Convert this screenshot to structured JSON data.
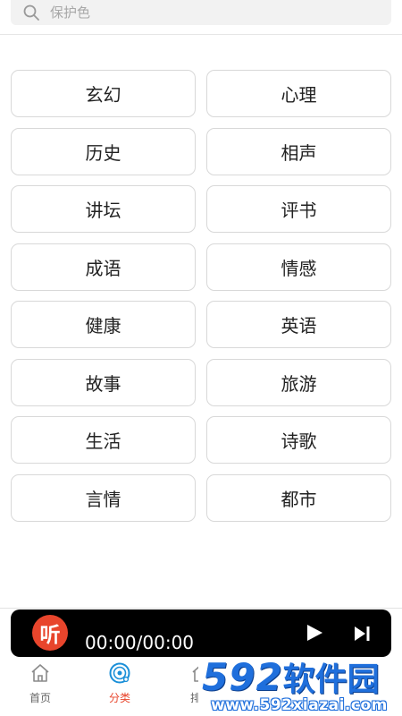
{
  "search": {
    "placeholder": "保护色",
    "icon": "search-icon"
  },
  "categories": [
    {
      "label": "玄幻"
    },
    {
      "label": "心理"
    },
    {
      "label": "历史"
    },
    {
      "label": "相声"
    },
    {
      "label": "讲坛"
    },
    {
      "label": "评书"
    },
    {
      "label": "成语"
    },
    {
      "label": "情感"
    },
    {
      "label": "健康"
    },
    {
      "label": "英语"
    },
    {
      "label": "故事"
    },
    {
      "label": "旅游"
    },
    {
      "label": "生活"
    },
    {
      "label": "诗歌"
    },
    {
      "label": "言情"
    },
    {
      "label": "都市"
    }
  ],
  "player": {
    "logo_text": "听",
    "time": "00:00/00:00",
    "play_icon": "play-icon",
    "next_icon": "skip-next-icon"
  },
  "tabs": [
    {
      "label": "首页",
      "icon": "home-icon",
      "active": false
    },
    {
      "label": "分类",
      "icon": "disc-icon",
      "active": true
    },
    {
      "label": "排",
      "icon": "rank-icon",
      "active": false
    }
  ],
  "watermark": {
    "brand_number": "592",
    "brand_name": "软件园",
    "url": "www.592xiazai.com"
  },
  "colors": {
    "accent": "#e8452c",
    "tab_active_icon": "#1a8fd8",
    "player_bg": "#000000",
    "watermark_blue": "#1f6fdc"
  }
}
